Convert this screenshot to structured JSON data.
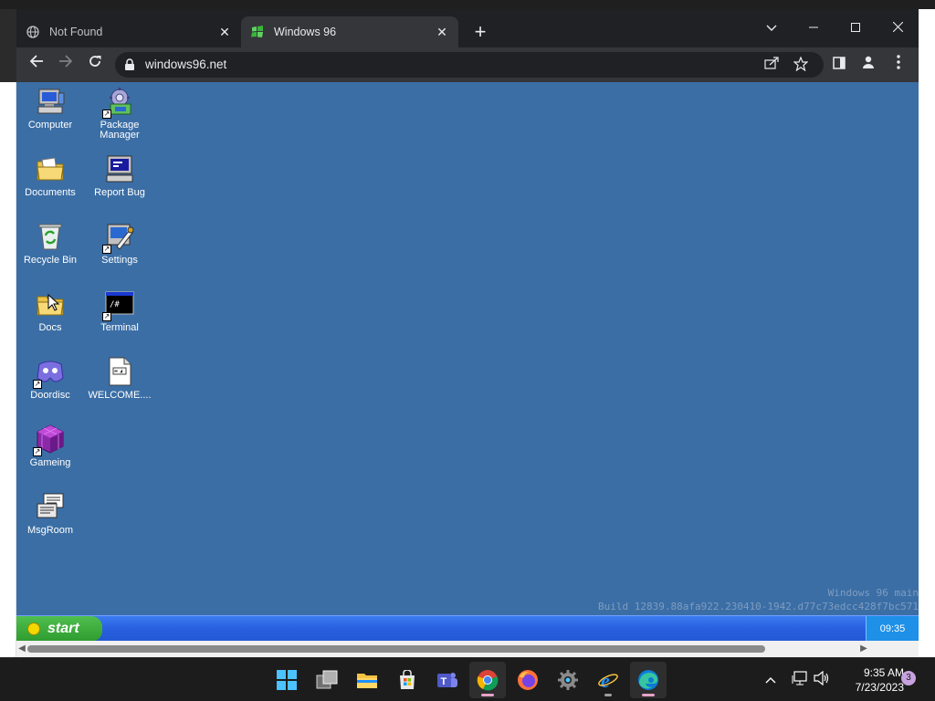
{
  "browser": {
    "tabs": [
      {
        "label": "Not Found",
        "close": "✕",
        "active": false
      },
      {
        "label": "Windows 96",
        "close": "✕",
        "active": true
      }
    ],
    "new_tab": "+",
    "url": "windows96.net"
  },
  "desktop": {
    "icons": [
      {
        "label": "Computer",
        "icon": "computer-icon"
      },
      {
        "label": "Package Manager",
        "icon": "package-manager-icon"
      },
      {
        "label": "Documents",
        "icon": "documents-folder-icon"
      },
      {
        "label": "Report Bug",
        "icon": "report-bug-icon"
      },
      {
        "label": "Recycle Bin",
        "icon": "recycle-bin-icon"
      },
      {
        "label": "Settings",
        "icon": "settings-icon"
      },
      {
        "label": "Docs",
        "icon": "docs-folder-icon"
      },
      {
        "label": "Terminal",
        "icon": "terminal-icon"
      },
      {
        "label": "Doordisc",
        "icon": "doordisc-icon"
      },
      {
        "label": "WELCOME....",
        "icon": "text-file-icon"
      },
      {
        "label": "Gameing",
        "icon": "gameing-icon"
      },
      {
        "label": "MsgRoom",
        "icon": "msgroom-icon"
      }
    ],
    "build_line1": "Windows 96 main",
    "build_line2": "Build 12839.88afa922.230410-1942.d77c73edcc428f7bc571",
    "start_label": "start",
    "clock": "09:35"
  },
  "taskbar": {
    "time": "9:35 AM",
    "date": "7/23/2023",
    "notification_count": "3"
  },
  "colors": {
    "desktop_bg": "#3b6ea5",
    "w96_taskbar": "#2860e0",
    "start_green": "#2e9b2e",
    "chrome_dark": "#202124"
  }
}
